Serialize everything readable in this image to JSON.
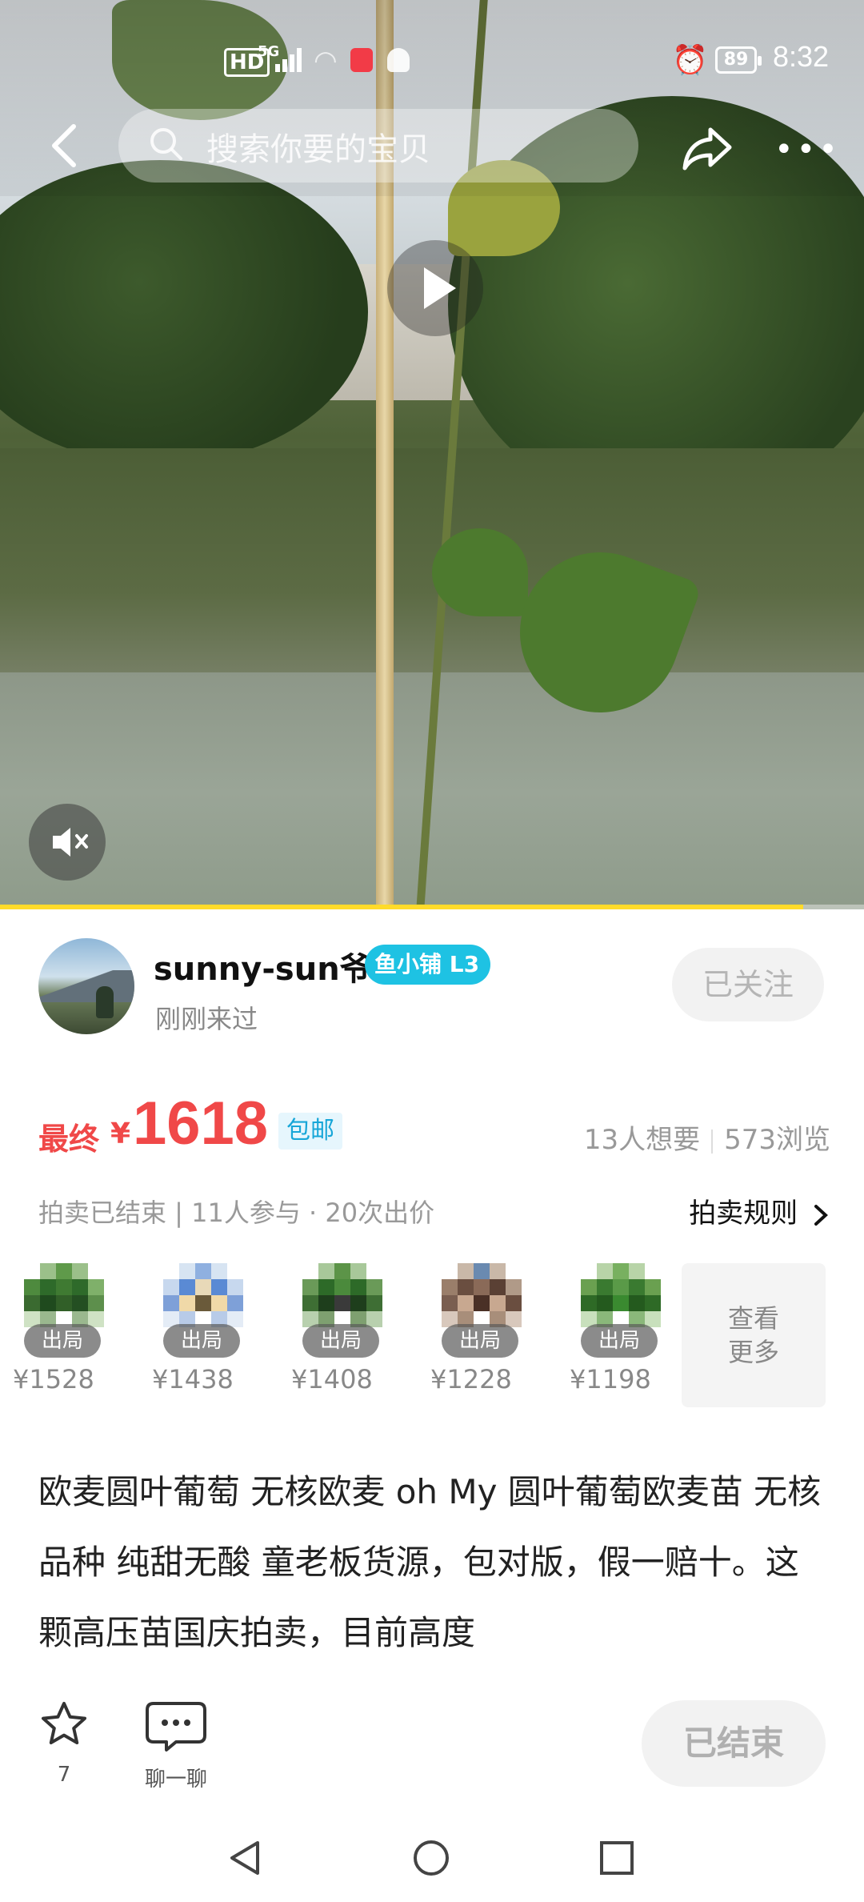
{
  "status_bar": {
    "hd": "HD",
    "network": "5G",
    "battery": "89",
    "time": "8:32"
  },
  "header": {
    "search_placeholder": "搜索你要的宝贝"
  },
  "seller": {
    "name": "sunny-sun爷",
    "badge": "鱼小铺 L3",
    "last_seen": "刚刚来过",
    "follow_label": "已关注"
  },
  "price": {
    "label": "最终",
    "currency": "¥",
    "amount": "1618",
    "shipping": "包邮",
    "wants": "13人想要",
    "views": "573浏览"
  },
  "auction": {
    "info": "拍卖已结束 | 11人参与 · 20次出价",
    "rules_label": "拍卖规则"
  },
  "bidders": [
    {
      "tag": "出局",
      "bid": "¥1528"
    },
    {
      "tag": "出局",
      "bid": "¥1438"
    },
    {
      "tag": "出局",
      "bid": "¥1408"
    },
    {
      "tag": "出局",
      "bid": "¥1228"
    },
    {
      "tag": "出局",
      "bid": "¥1198"
    }
  ],
  "more_bidders": "查看\n更多",
  "description": "欧麦圆叶葡萄  无核欧麦 oh My 圆叶葡萄欧麦苗 无核品种   纯甜无酸 童老板货源，包对版，假一赔十。这颗高压苗国庆拍卖，目前高度",
  "actions": {
    "favorite_count": "7",
    "chat_label": "聊一聊",
    "status_label": "已结束"
  },
  "video": {
    "progress": 0.93
  }
}
